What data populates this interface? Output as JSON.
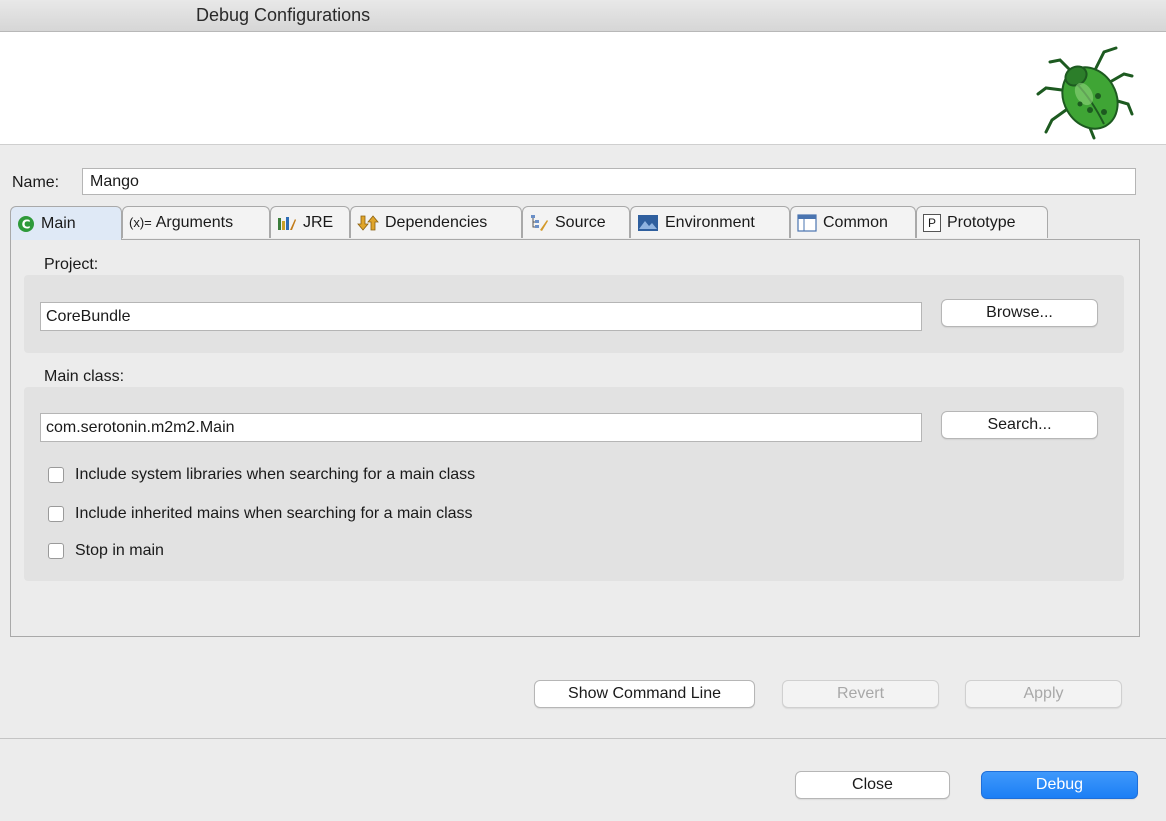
{
  "window": {
    "title": "Debug Configurations"
  },
  "name_field": {
    "label": "Name:",
    "value": "Mango"
  },
  "tabs": [
    {
      "label": "Main",
      "icon": "main-class-icon",
      "active": true
    },
    {
      "label": "Arguments",
      "icon": "arguments-icon",
      "active": false
    },
    {
      "label": "JRE",
      "icon": "jre-library-icon",
      "active": false
    },
    {
      "label": "Dependencies",
      "icon": "dependencies-icon",
      "active": false
    },
    {
      "label": "Source",
      "icon": "source-icon",
      "active": false
    },
    {
      "label": "Environment",
      "icon": "environment-icon",
      "active": false
    },
    {
      "label": "Common",
      "icon": "common-icon",
      "active": false
    },
    {
      "label": "Prototype",
      "icon": "prototype-icon",
      "active": false
    }
  ],
  "arguments_prefix": "(x)=",
  "prototype_prefix": "P",
  "main_tab": {
    "project": {
      "label": "Project:",
      "value": "CoreBundle",
      "browse_label": "Browse..."
    },
    "main_class": {
      "label": "Main class:",
      "value": "com.serotonin.m2m2.Main",
      "search_label": "Search..."
    },
    "checkboxes": [
      {
        "label": "Include system libraries when searching for a main class",
        "checked": false
      },
      {
        "label": "Include inherited mains when searching for a main class",
        "checked": false
      },
      {
        "label": "Stop in main",
        "checked": false
      }
    ]
  },
  "actions": {
    "show_command_line": "Show Command Line",
    "revert": "Revert",
    "apply": "Apply"
  },
  "footer": {
    "close": "Close",
    "debug": "Debug"
  },
  "colors": {
    "accent": "#1c7ff5",
    "active_tab": "#dfe9f6",
    "bug_green": "#3fa535"
  }
}
